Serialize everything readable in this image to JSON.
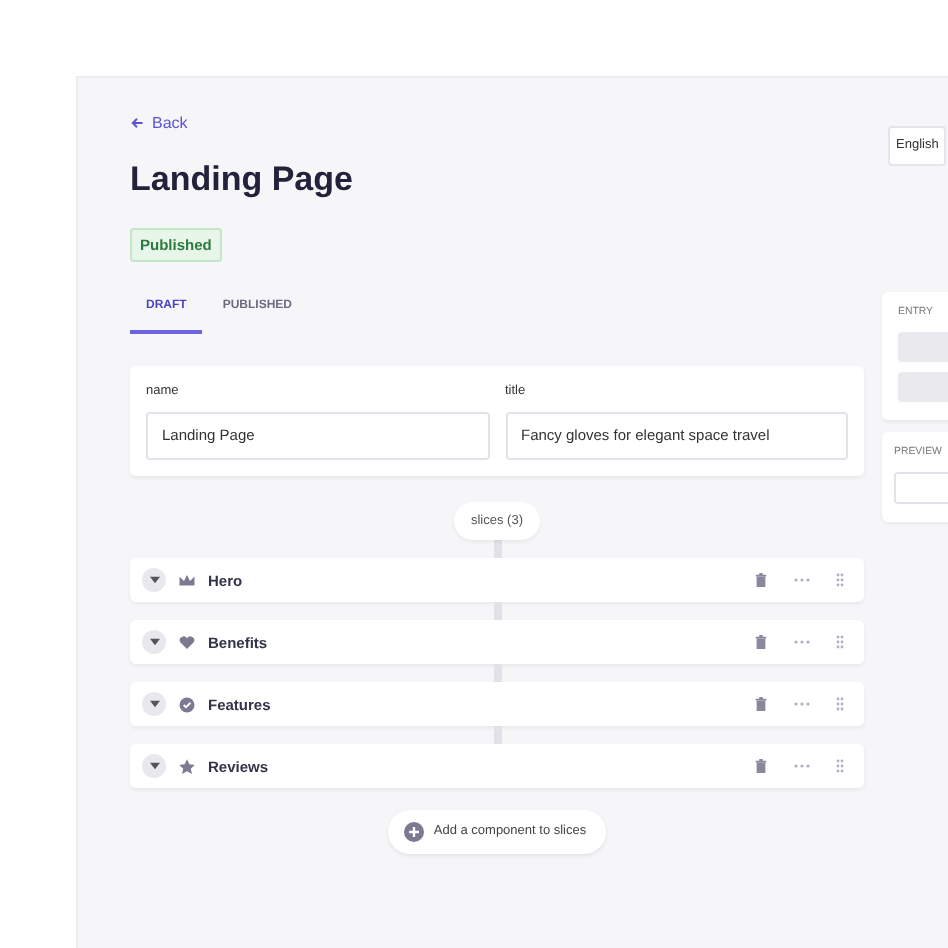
{
  "back_link": "Back",
  "title": "Landing Page",
  "status_badge": "Published",
  "tabs": [
    {
      "label": "DRAFT",
      "selected": true
    },
    {
      "label": "PUBLISHED",
      "selected": false
    }
  ],
  "language": "English",
  "fields": [
    {
      "label": "name",
      "value": "Landing Page"
    },
    {
      "label": "title",
      "value": "Fancy gloves for elegant space travel"
    }
  ],
  "slices_label": "slices (3)",
  "slices": [
    {
      "name": "Hero",
      "kind": "crown"
    },
    {
      "name": "Benefits",
      "kind": "heart"
    },
    {
      "name": "Features",
      "kind": "badge"
    },
    {
      "name": "Reviews",
      "kind": "star"
    }
  ],
  "add_button": "Add a component to slices",
  "sidebar": {
    "entry_label": "ENTRY",
    "preview_label": "PREVIEW"
  }
}
